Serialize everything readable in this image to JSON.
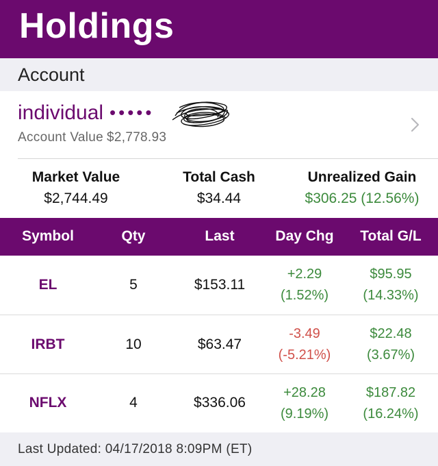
{
  "header": {
    "title": "Holdings"
  },
  "section": {
    "label": "Account"
  },
  "account": {
    "name": "individual",
    "masked": "•••••",
    "value_label": "Account Value",
    "value": "$2,778.93",
    "chevron_icon": "chevron-right-icon"
  },
  "summary": {
    "market_value_label": "Market Value",
    "market_value": "$2,744.49",
    "total_cash_label": "Total Cash",
    "total_cash": "$34.44",
    "unrealized_label": "Unrealized Gain",
    "unrealized": "$306.25 (12.56%)"
  },
  "table": {
    "headers": [
      "Symbol",
      "Qty",
      "Last",
      "Day Chg",
      "Total G/L"
    ],
    "rows": [
      {
        "symbol": "EL",
        "qty": "5",
        "last": "$153.11",
        "day_chg": "+2.29",
        "day_pct": "(1.52%)",
        "gl": "$95.95",
        "gl_pct": "(14.33%)"
      },
      {
        "symbol": "IRBT",
        "qty": "10",
        "last": "$63.47",
        "day_chg": "-3.49",
        "day_pct": "(-5.21%)",
        "gl": "$22.48",
        "gl_pct": "(3.67%)"
      },
      {
        "symbol": "NFLX",
        "qty": "4",
        "last": "$336.06",
        "day_chg": "+28.28",
        "day_pct": "(9.19%)",
        "gl": "$187.82",
        "gl_pct": "(16.24%)"
      }
    ]
  },
  "footer": {
    "last_updated": "Last Updated: 04/17/2018 8:09PM (ET)"
  },
  "colors": {
    "brand": "#6b0a6e",
    "positive": "#3c8a3c",
    "negative": "#d0504a",
    "section_bg": "#efeff4"
  }
}
